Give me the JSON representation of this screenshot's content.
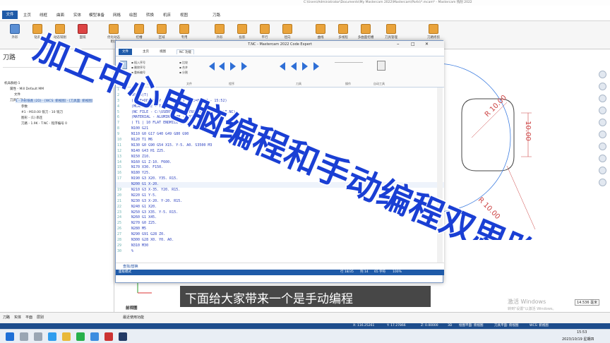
{
  "app": {
    "title": "C:\\Users\\Administrator\\Documents\\My Mastercam 2022\\Mastercam\\Parts\\*.mcam* - Mastercam 铣削 2022",
    "menu": [
      "文件",
      "主页",
      "线框",
      "曲面",
      "实体",
      "模型准备",
      "网格",
      "绘图",
      "转换",
      "机床",
      "视图",
      "刀路"
    ],
    "file_tab": "文件"
  },
  "ribbon": {
    "buttons": [
      "外形",
      "钻孔",
      "动态铣削",
      "面铣",
      "优化动态粗切",
      "挖槽",
      "区域",
      "专用",
      "外形",
      "投影",
      "平行",
      "径向",
      "曲线",
      "多线程",
      "多曲面挖槽",
      "曲线刀路",
      "刀具管理",
      "刀路修剪"
    ],
    "group_labels": [
      "2D",
      "3D",
      "工具"
    ]
  },
  "left_panel": {
    "title": "刀路",
    "tree": [
      "机床群组-1",
      "属性 - Mill Default MM",
      "文件",
      "刀具设置",
      "毛坯设置",
      "刀具群组-1",
      "1 - 外形铣削 (2D) - [WCS: 俯视图] - [刀具面: 俯视图]",
      "参数",
      "#1 - M10.00 铣刀 - 10 铣刀",
      "图形 - (1) 串连",
      "刀路 - 1.9K - T.NC - 程序编号 0"
    ]
  },
  "dialog": {
    "title": "T.NC - Mastercam 2022 Code Expert",
    "tabs": [
      "文件",
      "主页",
      "视图",
      "NC 功能"
    ],
    "group_labels": [
      "格式",
      "编辑",
      "文件",
      "程序",
      "刀具",
      "操作",
      "自动工具"
    ],
    "find_label": "查找/替换",
    "status_left": "面板模式",
    "status_right": [
      "行 18/35",
      "列 14",
      "65 字符",
      "100%"
    ]
  },
  "code": {
    "lines": [
      {
        "n": "1",
        "t": "%"
      },
      {
        "n": "2",
        "t": "O0000(T)"
      },
      {
        "n": "3",
        "t": "(DATE=DD-MM-YY - 19-10-23 TIME=HH:MM - 15:52)"
      },
      {
        "n": "4",
        "t": "(MCAM FILE - T)"
      },
      {
        "n": "5",
        "t": "(NC FILE - C:\\USERS\\ADMINISTRATOR\\DOCUMENTS\\T.NC)"
      },
      {
        "n": "6",
        "t": "(MATERIAL - ALUMINUM MM - 2024)"
      },
      {
        "n": "7",
        "t": "( T1 | 10 FLAT ENDMILL | H1 )"
      },
      {
        "n": "8",
        "t": "N100 G21"
      },
      {
        "n": "9",
        "t": "N110 G0 G17 G40 G49 G80 G90"
      },
      {
        "n": "10",
        "t": "N120 T1 M6"
      },
      {
        "n": "11",
        "t": "N130 G0 G90 G54 X15. Y-5. A0. S3500 M3"
      },
      {
        "n": "12",
        "t": "N140 G43 H1 Z25."
      },
      {
        "n": "13",
        "t": "N150 Z10."
      },
      {
        "n": "14",
        "t": "N160 G1 Z-10. F600."
      },
      {
        "n": "15",
        "t": "N170 X30. F150."
      },
      {
        "n": "16",
        "t": "N180 Y25."
      },
      {
        "n": "17",
        "t": "N190 G3 X20. Y35. R15."
      },
      {
        "n": "18",
        "t": "N200 G1 X-20."
      },
      {
        "n": "19",
        "t": "N210 G3 X-35. Y20. R15."
      },
      {
        "n": "20",
        "t": "N220 G1 Y-5."
      },
      {
        "n": "21",
        "t": "N230 G3 X-20. Y-20. R15."
      },
      {
        "n": "22",
        "t": "N240 G1 X20."
      },
      {
        "n": "23",
        "t": "N250 G3 X35. Y-5. R15."
      },
      {
        "n": "24",
        "t": "N260 G1 X45."
      },
      {
        "n": "25",
        "t": "N270 G0 Z25."
      },
      {
        "n": "26",
        "t": "N280 M5"
      },
      {
        "n": "27",
        "t": "N290 G91 G28 Z0."
      },
      {
        "n": "28",
        "t": "N300 G28 X0. Y0. A0."
      },
      {
        "n": "29",
        "t": "N310 M30"
      },
      {
        "n": "30",
        "t": "%"
      }
    ]
  },
  "viewport": {
    "dims": [
      "R 10.00",
      "10.00",
      "R 10.00"
    ],
    "view_label": "前视图",
    "scale": "14.536 毫米",
    "scale_unit": "毫米",
    "watermark": "激活 Windows",
    "watermark_sub": "转到\"设置\"以激活 Windows。"
  },
  "bottom_tabs": [
    "刀路",
    "实体",
    "平面",
    "层别",
    "最近使用功能"
  ],
  "app_status": {
    "items": [
      "X: 116.25261",
      "Y: 17.27866",
      "Z: 0.00000",
      "3D",
      "绘图平面: 俯视图",
      "刀具平面: 俯视图",
      "WCS: 俯视图"
    ]
  },
  "taskbar": {
    "time": "15:53",
    "date": "2023/10/19 星期四"
  },
  "overlay": {
    "title": "加工中心电脑编程和手动编程双思路",
    "title_color": "#1a3fd4",
    "outline_color": "#ffffff",
    "subtitle": "下面给大家带来一个是手动编程"
  },
  "colors": {
    "accent": "#1e5aa8",
    "code_text": "#2a3fbf",
    "arrow_blue": "#2f6fd6"
  }
}
